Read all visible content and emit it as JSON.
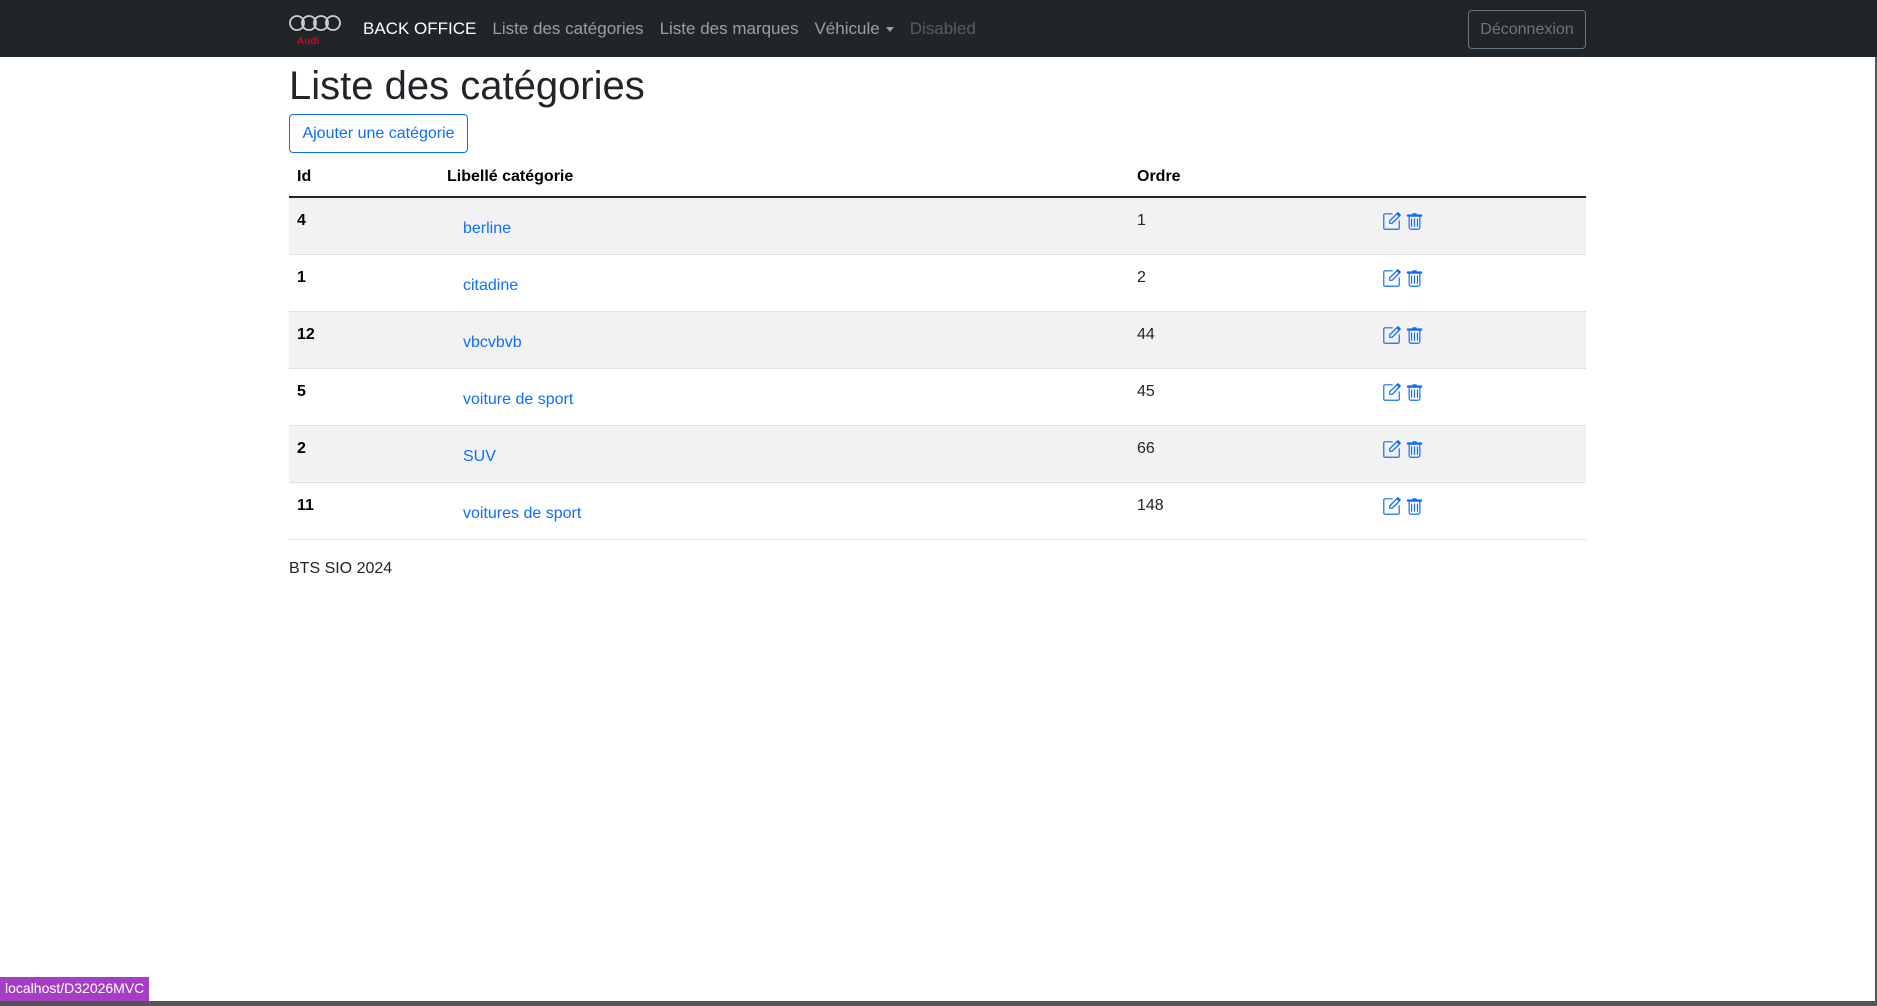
{
  "navbar": {
    "brand": "BACK OFFICE",
    "logo_text": "Audi",
    "links": [
      "Liste des catégories",
      "Liste des marques"
    ],
    "dropdown_label": "Véhicule",
    "disabled_label": "Disabled",
    "logout_label": "Déconnexion"
  },
  "main": {
    "title": "Liste des catégories",
    "add_button": "Ajouter une catégorie",
    "table": {
      "headers": [
        "Id",
        "Libellé catégorie",
        "Ordre",
        ""
      ],
      "rows": [
        {
          "id": "4",
          "label": "berline",
          "order": "1"
        },
        {
          "id": "1",
          "label": "citadine",
          "order": "2"
        },
        {
          "id": "12",
          "label": "vbcvbvb",
          "order": "44"
        },
        {
          "id": "5",
          "label": "voiture de sport",
          "order": "45"
        },
        {
          "id": "2",
          "label": "SUV",
          "order": "66"
        },
        {
          "id": "11",
          "label": "voitures de sport",
          "order": "148"
        }
      ]
    },
    "footer": "BTS SIO 2024"
  },
  "statusbar": {
    "url": "localhost/D32026MVC"
  },
  "colors": {
    "primary": "#0d6efd",
    "navbar": "#212529",
    "brand_red": "#e2001a",
    "status": "#a53ec4"
  },
  "icons": {
    "edit": "edit-icon",
    "delete": "trash-icon"
  }
}
